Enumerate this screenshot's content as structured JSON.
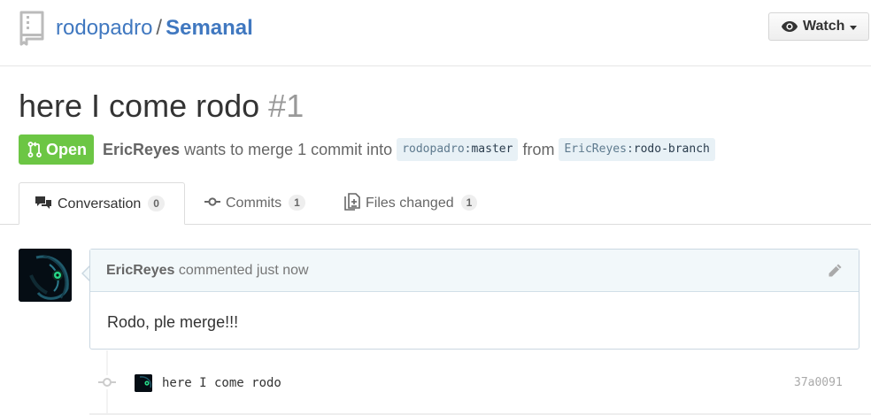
{
  "repo": {
    "owner": "rodopadro",
    "separator": "/",
    "name": "Semanal",
    "icon": "repo-icon"
  },
  "watch_button": {
    "label": "Watch",
    "icon": "eye-icon"
  },
  "pull_request": {
    "title": "here I come rodo",
    "number": "#1",
    "state": "Open",
    "state_color": "#6cc644",
    "author": "EricReyes",
    "merge_text": "wants to merge 1 commit into",
    "base_user": "rodopadro",
    "base_branch": "master",
    "from_text": "from",
    "head_user": "EricReyes",
    "head_branch": "rodo-branch"
  },
  "tabs": [
    {
      "label": "Conversation",
      "count": "0",
      "icon": "comment-discussion-icon",
      "selected": true
    },
    {
      "label": "Commits",
      "count": "1",
      "icon": "git-commit-icon",
      "selected": false
    },
    {
      "label": "Files changed",
      "count": "1",
      "icon": "diff-icon",
      "selected": false
    }
  ],
  "comment": {
    "author": "EricReyes",
    "action": "commented just now",
    "body": "Rodo, ple merge!!!",
    "edit_icon": "pencil-icon"
  },
  "commit": {
    "message": "here I come rodo",
    "sha": "37a0091"
  },
  "colors": {
    "link": "#4078c0",
    "ref_bg": "#e8f1f6",
    "comment_header_bg": "#f2f8fa"
  }
}
